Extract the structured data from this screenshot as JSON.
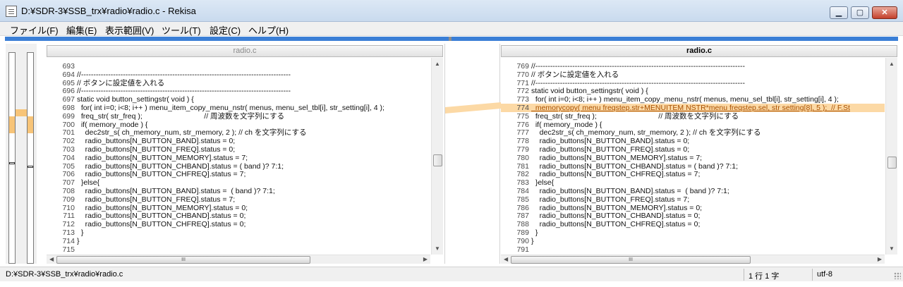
{
  "window": {
    "title": "D:¥SDR-3¥SSB_trx¥radio¥radio.c - Rekisa",
    "buttons": {
      "minimize": "▁",
      "maximize": "▢",
      "close": "✕"
    }
  },
  "menu": [
    "ファイル(F)",
    "編集(E)",
    "表示範囲(V)",
    "ツール(T)",
    "設定(C)",
    "ヘルプ(H)"
  ],
  "colors": {
    "accent": "#3b7fd6",
    "changed_line": "#fcd9a5",
    "changed_text": "#a84f00"
  },
  "left_pane": {
    "filename": "radio.c",
    "hscroll_label": "III",
    "lines": [
      {
        "num": "693",
        "text": ""
      },
      {
        "num": "694",
        "text": "//-------------------------------------------------------------------------------------"
      },
      {
        "num": "695",
        "text": "// ボタンに設定値を入れる"
      },
      {
        "num": "696",
        "text": "//-------------------------------------------------------------------------------------"
      },
      {
        "num": "697",
        "text": "static void button_settingstr( void ) {"
      },
      {
        "num": "698",
        "text": "  for( int i=0; i<8; i++ ) menu_item_copy_menu_nstr( menus, menu_sel_tbl[i], str_setting[i], 4 );"
      },
      {
        "num": "699",
        "text": "  freq_str( str_freq );                              // 周波数を文字列にする"
      },
      {
        "num": "700",
        "text": "  if( memory_mode ) {"
      },
      {
        "num": "701",
        "text": "    dec2str_s( ch_memory_num, str_memory, 2 ); // ch を文字列にする"
      },
      {
        "num": "702",
        "text": "    radio_buttons[N_BUTTON_BAND].status = 0;"
      },
      {
        "num": "703",
        "text": "    radio_buttons[N_BUTTON_FREQ].status = 0;"
      },
      {
        "num": "704",
        "text": "    radio_buttons[N_BUTTON_MEMORY].status = 7;"
      },
      {
        "num": "705",
        "text": "    radio_buttons[N_BUTTON_CHBAND].status = ( band )? 7:1;"
      },
      {
        "num": "706",
        "text": "    radio_buttons[N_BUTTON_CHFREQ].status = 7;"
      },
      {
        "num": "707",
        "text": "  }else{"
      },
      {
        "num": "708",
        "text": "    radio_buttons[N_BUTTON_BAND].status =  ( band )? 7:1;"
      },
      {
        "num": "709",
        "text": "    radio_buttons[N_BUTTON_FREQ].status = 7;"
      },
      {
        "num": "710",
        "text": "    radio_buttons[N_BUTTON_MEMORY].status = 0;"
      },
      {
        "num": "711",
        "text": "    radio_buttons[N_BUTTON_CHBAND].status = 0;"
      },
      {
        "num": "712",
        "text": "    radio_buttons[N_BUTTON_CHFREQ].status = 0;"
      },
      {
        "num": "713",
        "text": "  }"
      },
      {
        "num": "714",
        "text": "}"
      },
      {
        "num": "715",
        "text": ""
      }
    ]
  },
  "right_pane": {
    "filename": "radio.c",
    "hscroll_label": "III",
    "lines": [
      {
        "num": "769",
        "text": "//-------------------------------------------------------------------------------------"
      },
      {
        "num": "770",
        "text": "// ボタンに設定値を入れる"
      },
      {
        "num": "771",
        "text": "//-------------------------------------------------------------------------------------"
      },
      {
        "num": "772",
        "text": "static void button_settingstr( void ) {"
      },
      {
        "num": "773",
        "text": "  for( int i=0; i<8; i++ ) menu_item_copy_menu_nstr( menus, menu_sel_tbl[i], str_setting[i], 4 );"
      },
      {
        "num": "774",
        "text": "  memorycopy( menu freqstep.str+MENUITEM NSTR*menu freqstep.sel, str setting[8], 5 );  // F.St",
        "changed": true
      },
      {
        "num": "775",
        "text": "  freq_str( str_freq );                              // 周波数を文字列にする"
      },
      {
        "num": "776",
        "text": "  if( memory_mode ) {"
      },
      {
        "num": "777",
        "text": "    dec2str_s( ch_memory_num, str_memory, 2 ); // ch を文字列にする"
      },
      {
        "num": "778",
        "text": "    radio_buttons[N_BUTTON_BAND].status = 0;"
      },
      {
        "num": "779",
        "text": "    radio_buttons[N_BUTTON_FREQ].status = 0;"
      },
      {
        "num": "780",
        "text": "    radio_buttons[N_BUTTON_MEMORY].status = 7;"
      },
      {
        "num": "781",
        "text": "    radio_buttons[N_BUTTON_CHBAND].status = ( band )? 7:1;"
      },
      {
        "num": "782",
        "text": "    radio_buttons[N_BUTTON_CHFREQ].status = 7;"
      },
      {
        "num": "783",
        "text": "  }else{"
      },
      {
        "num": "784",
        "text": "    radio_buttons[N_BUTTON_BAND].status =  ( band )? 7:1;"
      },
      {
        "num": "785",
        "text": "    radio_buttons[N_BUTTON_FREQ].status = 7;"
      },
      {
        "num": "786",
        "text": "    radio_buttons[N_BUTTON_MEMORY].status = 0;"
      },
      {
        "num": "787",
        "text": "    radio_buttons[N_BUTTON_CHBAND].status = 0;"
      },
      {
        "num": "788",
        "text": "    radio_buttons[N_BUTTON_CHFREQ].status = 0;"
      },
      {
        "num": "789",
        "text": "  }"
      },
      {
        "num": "790",
        "text": "}"
      },
      {
        "num": "791",
        "text": ""
      }
    ]
  },
  "status": {
    "path": "D:¥SDR-3¥SSB_trx¥radio¥radio.c",
    "position": "1 行 1 字",
    "encoding": "utf-8"
  }
}
